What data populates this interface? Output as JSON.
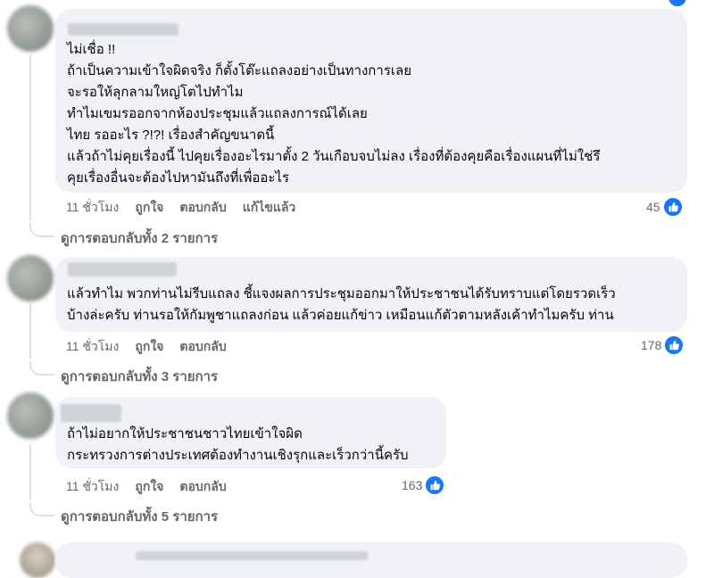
{
  "comments": [
    {
      "lines": [
        "ไม่เชื่อ !!",
        "ถ้าเป็นความเข้าใจผิดจริง ก็ตั้งโต๊ะแถลงอย่างเป็นทางการเลย",
        "จะรอให้ลุกลามใหญ่โตไปทำไม",
        "ทำไมเขมรออกจากห้องประชุมแล้วแถลงการณ์ได้เลย",
        "ไทย รออะไร ?!?! เรื่องสำคัญขนาดนี้",
        "แล้วถ้าไม่คุยเรื่องนี้ ไปคุยเรื่องอะไรมาตั้ง 2 วันเกือบจบไม่ลง เรื่องที่ต้องคุยคือเรื่องแผนที่ไม่ใช่รึ",
        "คุยเรื่องอื่นจะต้องไปหามันถึงที่เพื่ออะไร"
      ],
      "time": "11 ชั่วโมง",
      "like_label": "ถูกใจ",
      "reply_label": "ตอบกลับ",
      "edited_label": "แก้ไขแล้ว",
      "like_count": "45",
      "replies_label": "ดูการตอบกลับทั้ง 2 รายการ"
    },
    {
      "lines": [
        "แล้วทำไม พวกท่านไม่รีบแถลง ชี้แจงผลการประชุมออกมาให้ประชาชนได้รับทราบแต่โดยรวดเร็ว",
        "บ้างล่ะครับ ท่านรอให้กัมพูชาแถลงก่อน แล้วค่อยแก้ข่าว เหมือนแก้ตัวตามหลังเค้าทำไมครับ ท่าน"
      ],
      "time": "11 ชั่วโมง",
      "like_label": "ถูกใจ",
      "reply_label": "ตอบกลับ",
      "like_count": "178",
      "replies_label": "ดูการตอบกลับทั้ง 3 รายการ"
    },
    {
      "lines": [
        "ถ้าไม่อยากให้ประชาชนชาวไทยเข้าใจผิด",
        "กระทรวงการต่างประเทศต้องทำงานเชิงรุกและเร็วกว่านี้ครับ"
      ],
      "time": "11 ชั่วโมง",
      "like_label": "ถูกใจ",
      "reply_label": "ตอบกลับ",
      "like_count": "163",
      "replies_label": "ดูการตอบกลับทั้ง 5 รายการ"
    }
  ],
  "icons": {
    "like": "thumbs-up-icon"
  },
  "colors": {
    "bubble": "#f0f2f5",
    "meta": "#65676b",
    "like_blue": "#1877f2"
  }
}
